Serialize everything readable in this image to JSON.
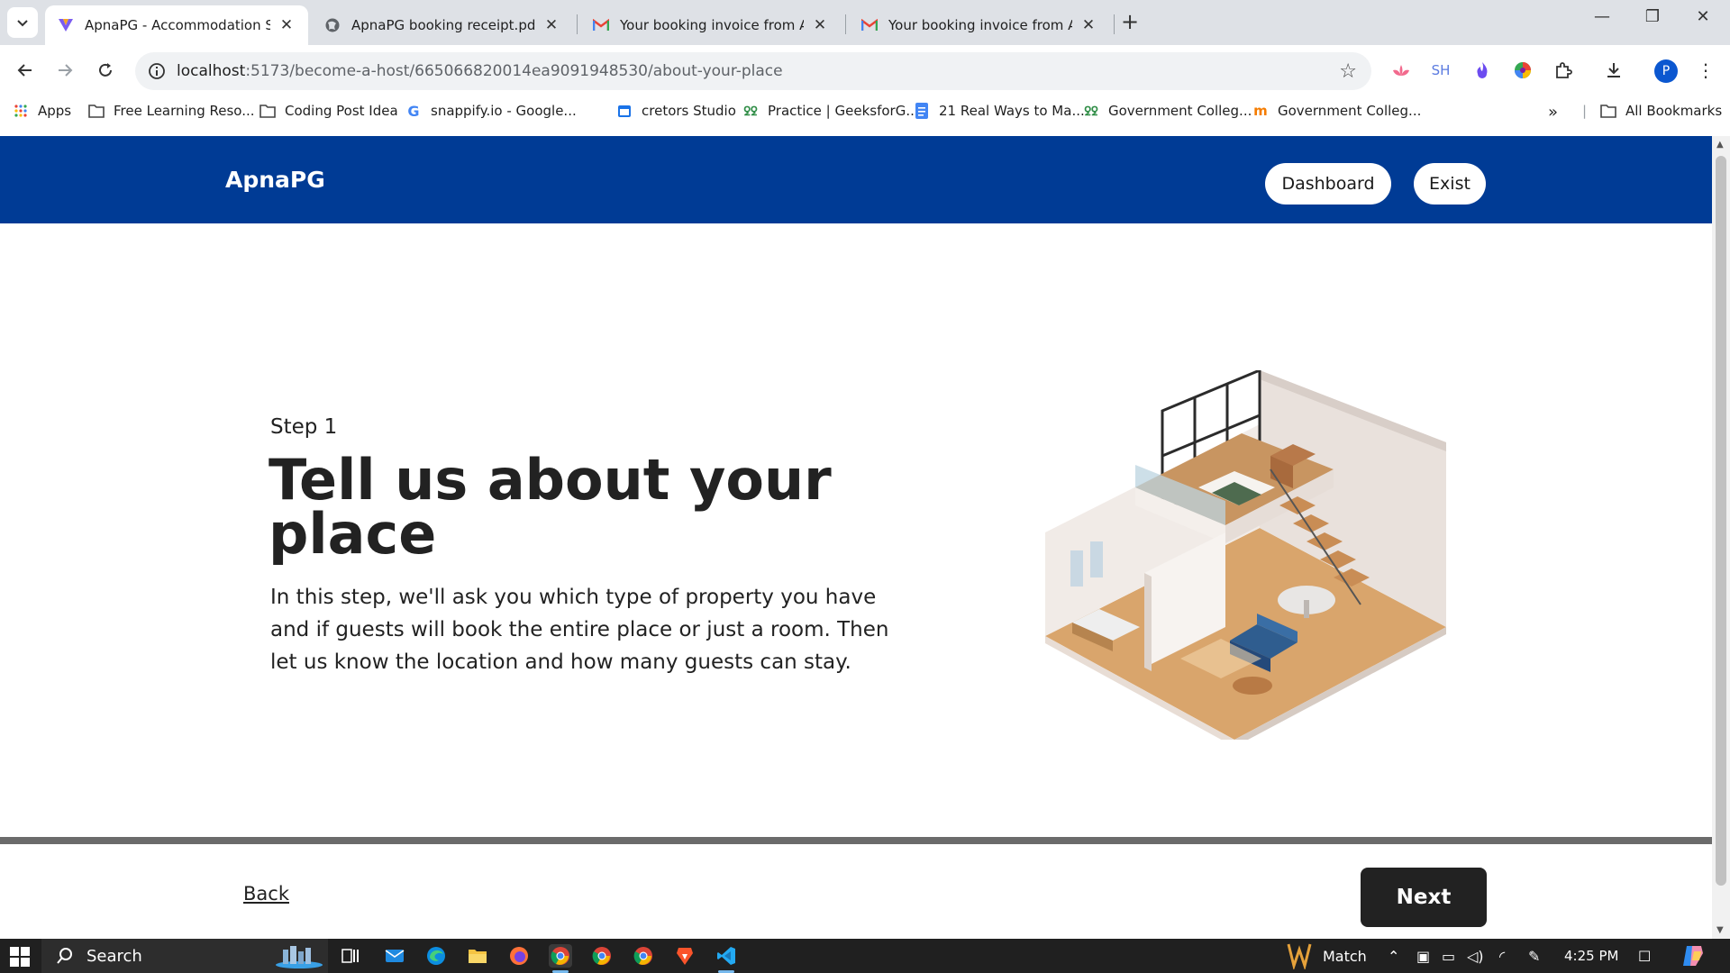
{
  "browser": {
    "tabs": [
      {
        "title": "ApnaPG - Accommodation Solu",
        "icon": "apnapg-favicon",
        "active": true
      },
      {
        "title": "ApnaPG booking receipt.pdf",
        "icon": "globe-icon",
        "active": false
      },
      {
        "title": "Your booking invoice from Apn",
        "icon": "gmail-icon",
        "active": false
      },
      {
        "title": "Your booking invoice from Apn",
        "icon": "gmail-icon",
        "active": false
      }
    ],
    "url_host": "localhost",
    "url_path": ":5173/become-a-host/665066820014ea9091948530/about-your-place",
    "extensions": {
      "sh_label": "SH",
      "profile_initial": "P"
    },
    "bookmarks": [
      {
        "label": "Apps",
        "icon": "apps-grid-icon"
      },
      {
        "label": "Free Learning Reso...",
        "icon": "folder-icon"
      },
      {
        "label": "Coding Post Idea",
        "icon": "folder-icon"
      },
      {
        "label": "snappify.io - Google...",
        "icon": "google-icon"
      },
      {
        "label": "cretors Studio",
        "icon": "calendar-icon"
      },
      {
        "label": "Practice | GeeksforG...",
        "icon": "geeksforgeeks-icon"
      },
      {
        "label": "21 Real Ways to Ma...",
        "icon": "docs-icon"
      },
      {
        "label": "Government Colleg...",
        "icon": "geeksforgeeks-icon"
      },
      {
        "label": "Government Colleg...",
        "icon": "shiksha-icon"
      }
    ],
    "all_bookmarks": "All Bookmarks"
  },
  "app": {
    "brand": "ApnaPG",
    "dashboard_label": "Dashboard",
    "exist_label": "Exist",
    "step_label": "Step 1",
    "headline": "Tell us about your place",
    "description": "In this step, we'll ask you which type of property you have and if guests will book the entire place or just a room. Then let us know the location and how many guests can stay.",
    "back_label": "Back",
    "next_label": "Next"
  },
  "taskbar": {
    "search_label": "Search",
    "weather_label": "Match",
    "time": "4:25 PM"
  },
  "colors": {
    "header_blue": "#003b95",
    "next_button": "#222222"
  }
}
